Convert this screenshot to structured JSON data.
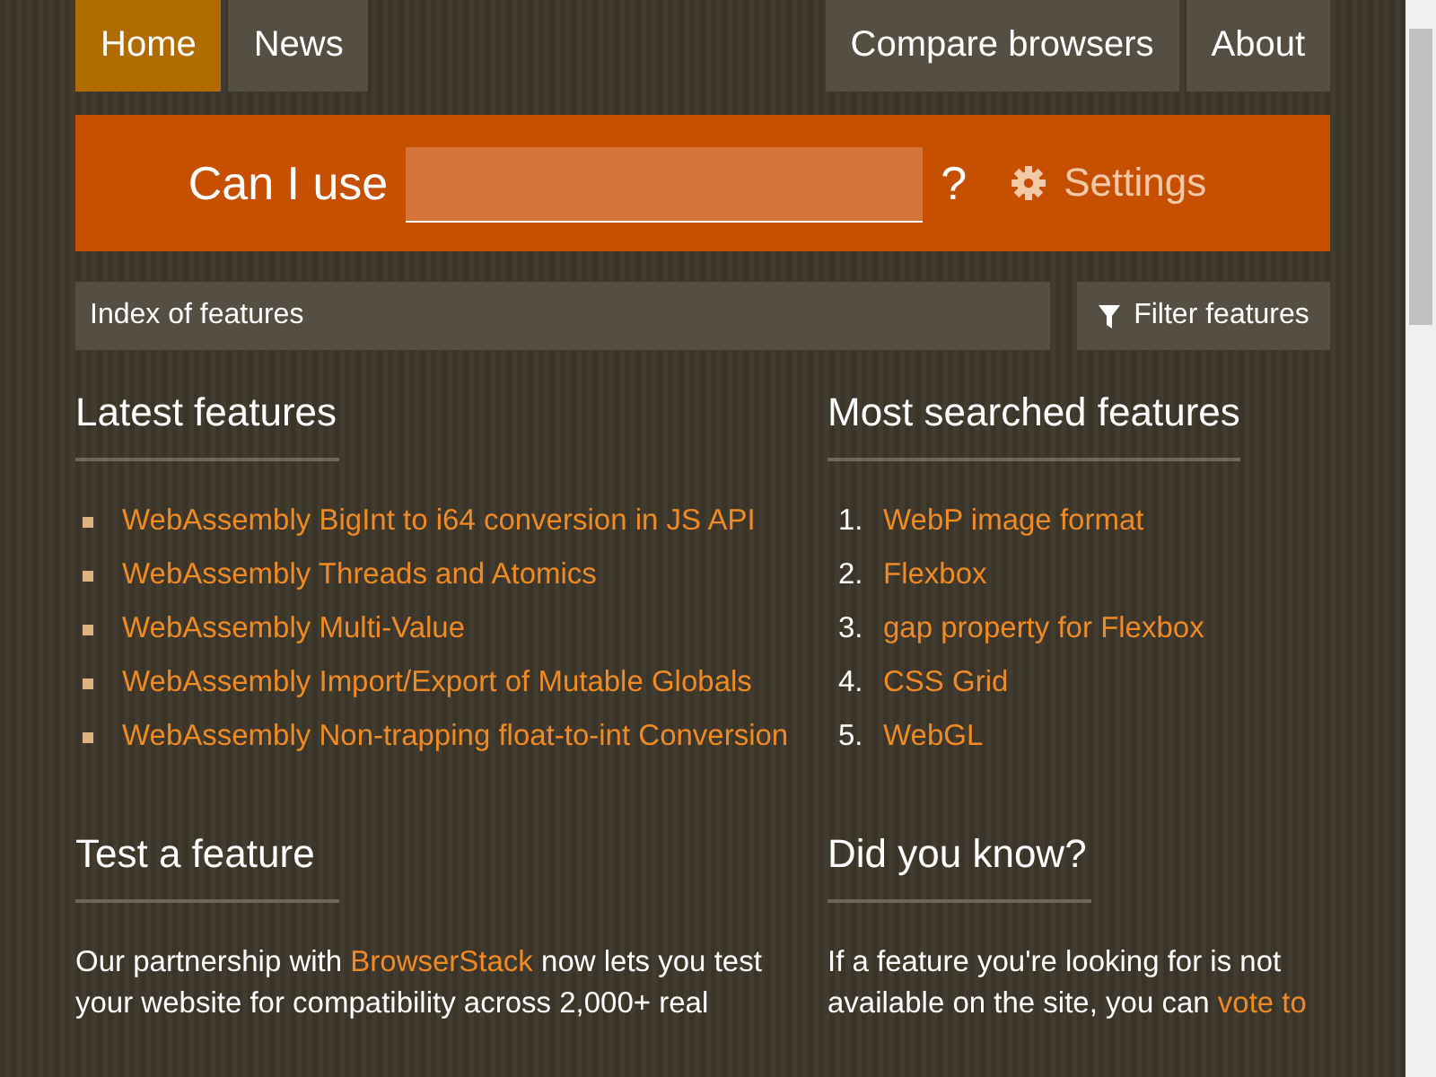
{
  "nav": {
    "left": [
      {
        "label": "Home",
        "selected": true
      },
      {
        "label": "News",
        "selected": false
      }
    ],
    "right": [
      {
        "label": "Compare browsers",
        "selected": false
      },
      {
        "label": "About",
        "selected": false
      }
    ]
  },
  "search": {
    "prefix": "Can I use",
    "suffix": "?",
    "settings": "Settings"
  },
  "filter": {
    "index_label": "Index of features",
    "button": "Filter features"
  },
  "latest": {
    "title": "Latest features",
    "items": [
      "WebAssembly BigInt to i64 conversion in JS API",
      "WebAssembly Threads and Atomics",
      "WebAssembly Multi-Value",
      "WebAssembly Import/Export of Mutable Globals",
      "WebAssembly Non-trapping float-to-int Conversion"
    ]
  },
  "most_searched": {
    "title": "Most searched features",
    "items": [
      {
        "number": "1.",
        "label": "WebP image format"
      },
      {
        "number": "2.",
        "label": "Flexbox"
      },
      {
        "number": "3.",
        "label": "gap property for Flexbox"
      },
      {
        "number": "4.",
        "label": "CSS Grid"
      },
      {
        "number": "5.",
        "label": "WebGL"
      }
    ]
  },
  "test": {
    "title": "Test a feature",
    "parts": [
      {
        "kind": "text",
        "text": "Our partnership with "
      },
      {
        "kind": "link",
        "text": "BrowserStack"
      },
      {
        "kind": "text",
        "text": " now lets you test your website for compatibility across 2,000+ real"
      }
    ]
  },
  "did_you_know": {
    "title": "Did you know?",
    "parts": [
      {
        "kind": "text",
        "text": "If a feature you're looking for is not available on the site, you can "
      },
      {
        "kind": "link",
        "text": "vote to"
      }
    ]
  }
}
